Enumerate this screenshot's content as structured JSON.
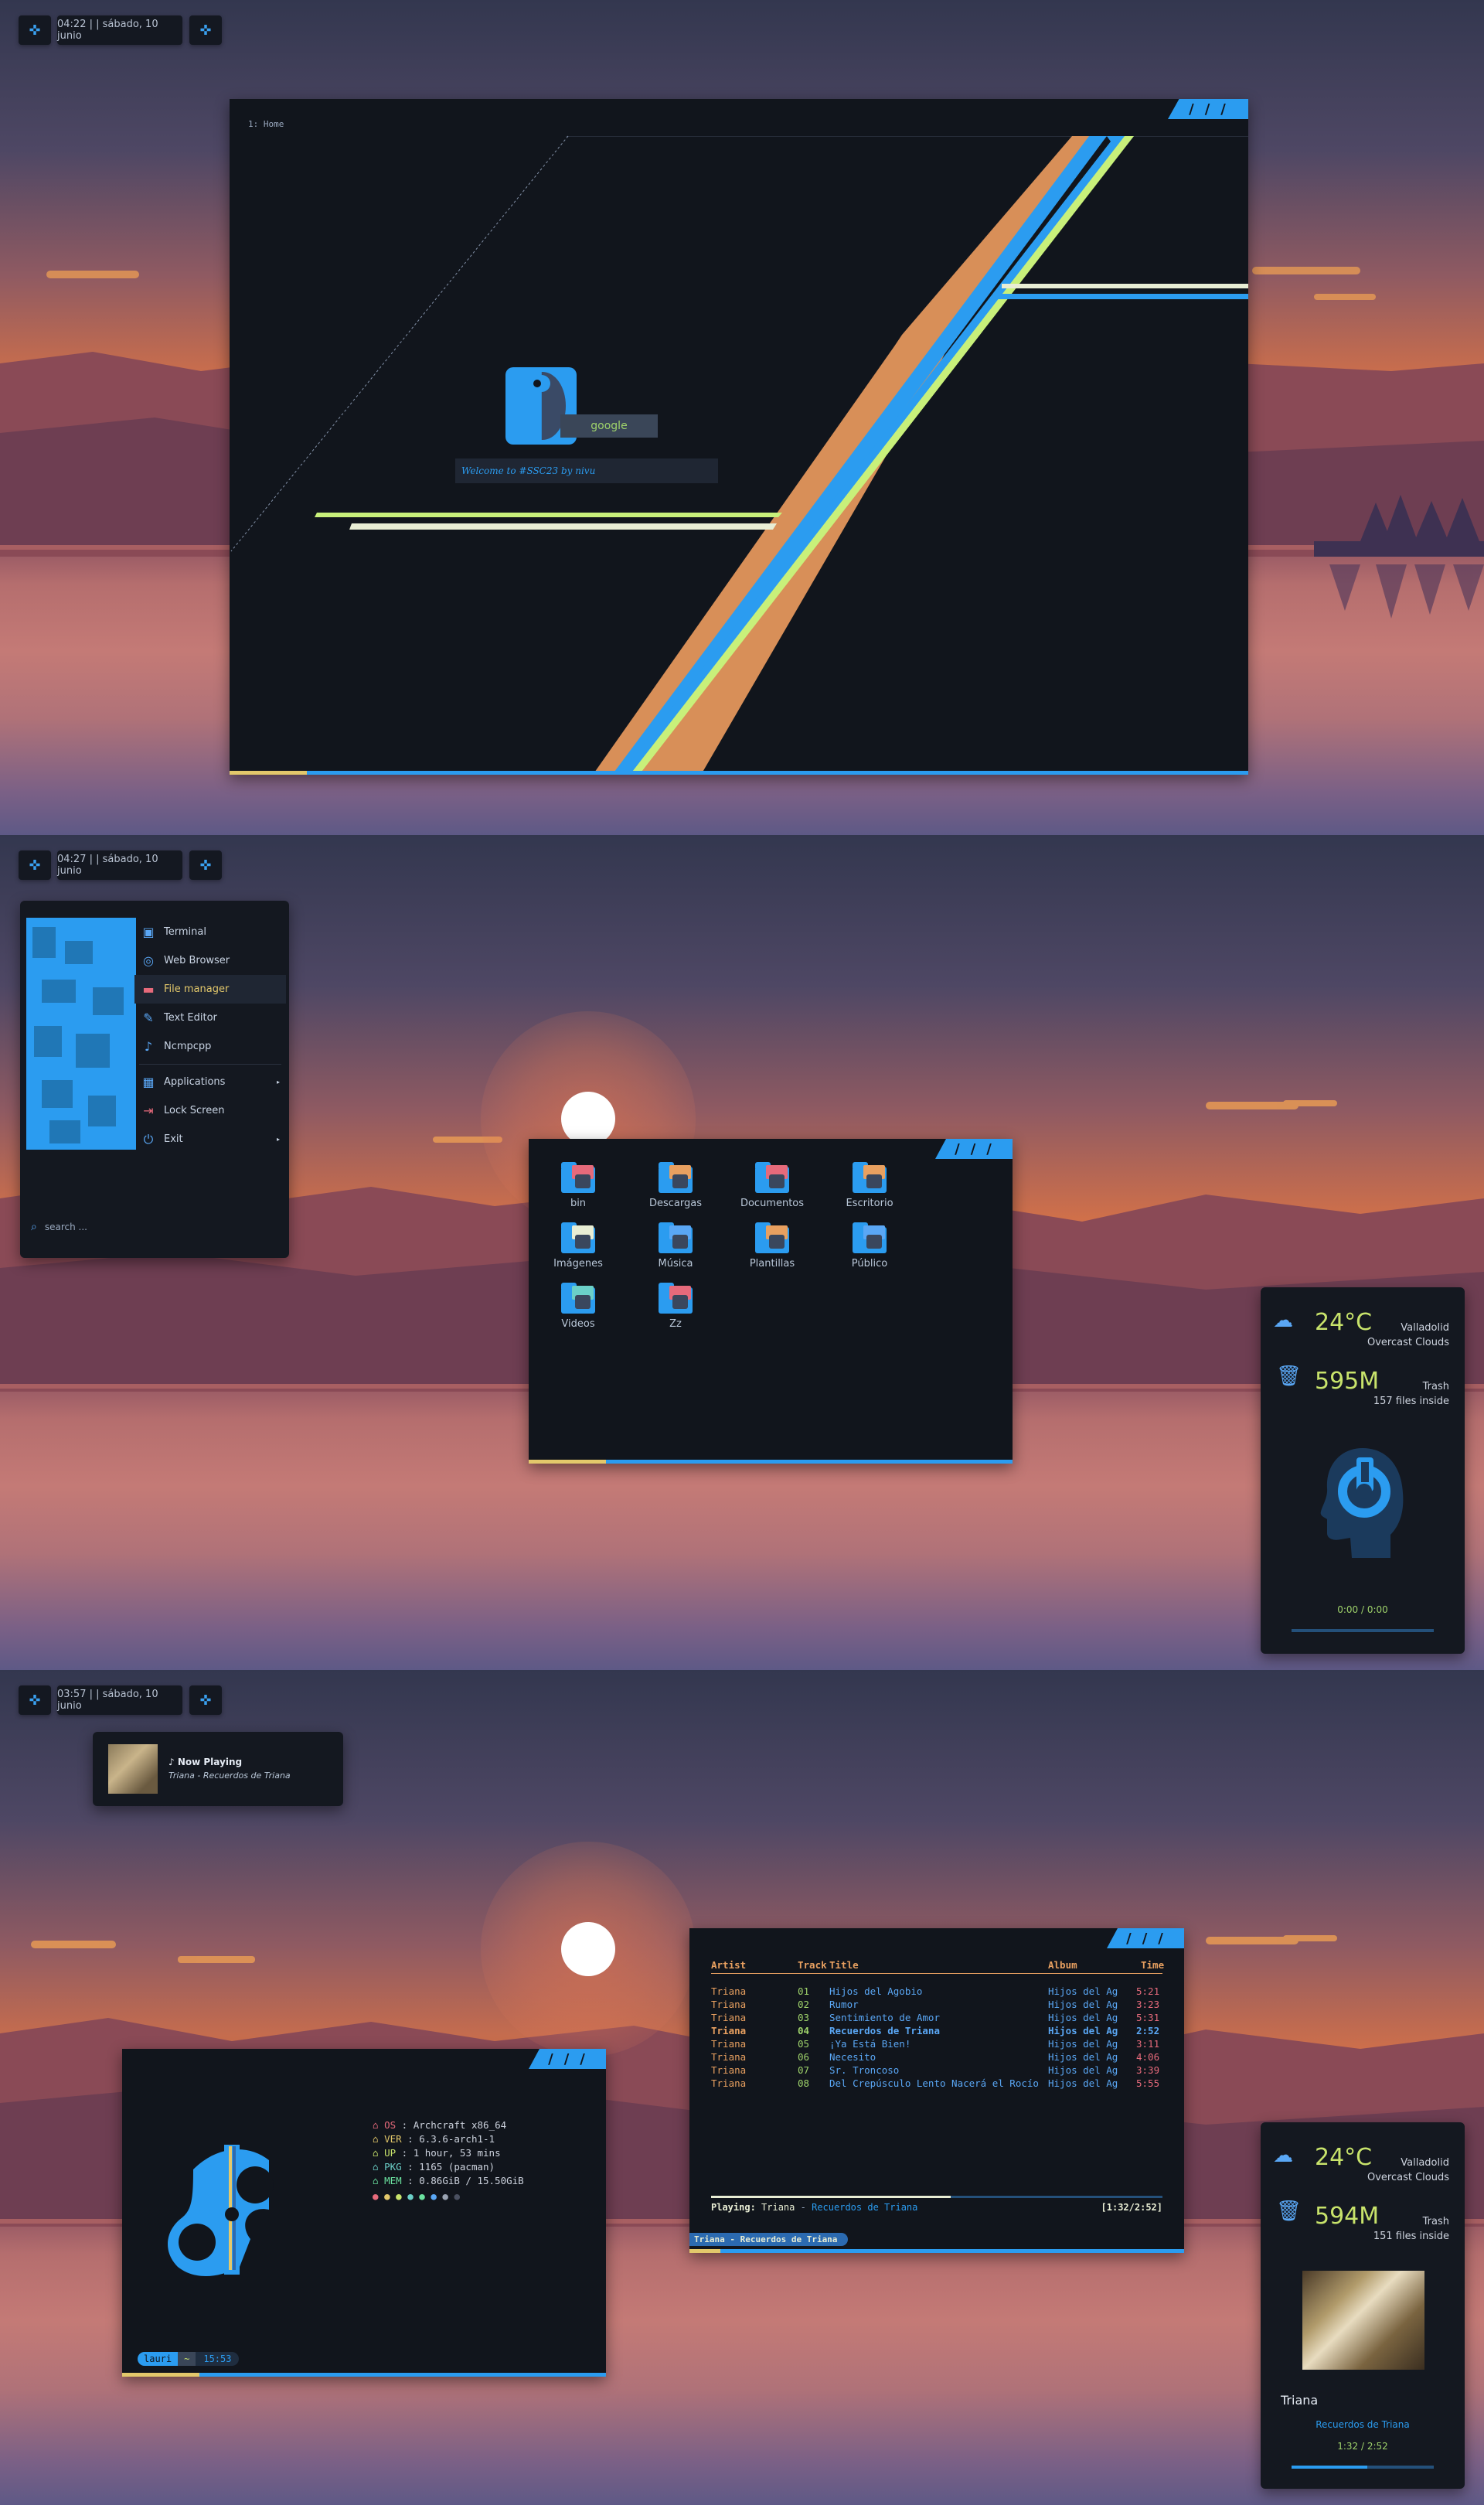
{
  "panels": [
    {
      "bar": {
        "time_date": "04:22 | | sábado, 10 junio"
      },
      "home_window": {
        "workspace": "1: Home",
        "google_label": "google",
        "welcome": "Welcome to #SSC23 by nivu"
      }
    },
    {
      "bar": {
        "time_date": "04:27 | | sábado, 10 junio"
      },
      "launcher": {
        "items": [
          {
            "label": "Terminal",
            "icon": "terminal-icon"
          },
          {
            "label": "Web Browser",
            "icon": "globe-icon"
          },
          {
            "label": "File manager",
            "icon": "folder-icon"
          },
          {
            "label": "Text Editor",
            "icon": "edit-icon"
          },
          {
            "label": "Ncmpcpp",
            "icon": "music-note-icon"
          }
        ],
        "items2": [
          {
            "label": "Applications",
            "icon": "grid-icon"
          },
          {
            "label": "Lock Screen",
            "icon": "lock-icon"
          },
          {
            "label": "Exit",
            "icon": "power-icon"
          }
        ],
        "search_placeholder": "search ..."
      },
      "files": [
        "bin",
        "Descargas",
        "Documentos",
        "Escritorio",
        "Imágenes",
        "Música",
        "Plantillas",
        "Público",
        "Videos",
        "Zz"
      ],
      "sidebar": {
        "temp": "24°C",
        "city": "Valladolid",
        "weather": "Overcast Clouds",
        "trash_size": "595M",
        "trash_label": "Trash",
        "trash_files": "157 files inside",
        "time": "0:00 / 0:00",
        "progress": 0
      }
    },
    {
      "bar": {
        "time_date": "03:57 | | sábado, 10 junio"
      },
      "now_playing": {
        "title": "♪ Now Playing",
        "track": "Triana - Recuerdos de Triana"
      },
      "fetch": {
        "lines": [
          {
            "key": "OS",
            "value": ": Archcraft x86_64",
            "color": "#e66a7b"
          },
          {
            "key": "VER",
            "value": ": 6.3.6-arch1-1",
            "color": "#e3c86b"
          },
          {
            "key": "UP",
            "value": ": 1 hour, 53 mins",
            "color": "#c8e36b"
          },
          {
            "key": "PKG",
            "value": ": 1165 (pacman)",
            "color": "#6bd0c8"
          },
          {
            "key": "MEM",
            "value": ": 0.86GiB / 15.50GiB",
            "color": "#6be3a0"
          }
        ],
        "dots": [
          "#e66a7b",
          "#e3c86b",
          "#c8e36b",
          "#6bd0c8",
          "#6be3a0",
          "#5aa7f5",
          "#9aa3b2",
          "#4a5060"
        ],
        "prompt_user": "lauri",
        "prompt_sep": "~",
        "prompt_time": "15:53"
      },
      "player": {
        "headers": [
          "Artist",
          "Track",
          "Title",
          "Album",
          "Time"
        ],
        "rows": [
          {
            "artist": "Triana",
            "track": "01",
            "title": "Hijos del Agobio",
            "album": "Hijos del Ag",
            "time": "5:21"
          },
          {
            "artist": "Triana",
            "track": "02",
            "title": "Rumor",
            "album": "Hijos del Ag",
            "time": "3:23"
          },
          {
            "artist": "Triana",
            "track": "03",
            "title": "Sentimiento de Amor",
            "album": "Hijos del Ag",
            "time": "5:31"
          },
          {
            "artist": "Triana",
            "track": "04",
            "title": "Recuerdos de Triana",
            "album": "Hijos del Ag",
            "time": "2:52"
          },
          {
            "artist": "Triana",
            "track": "05",
            "title": "¡Ya Está Bien!",
            "album": "Hijos del Ag",
            "time": "3:11"
          },
          {
            "artist": "Triana",
            "track": "06",
            "title": "Necesito",
            "album": "Hijos del Ag",
            "time": "4:06"
          },
          {
            "artist": "Triana",
            "track": "07",
            "title": "Sr. Troncoso",
            "album": "Hijos del Ag",
            "time": "3:39"
          },
          {
            "artist": "Triana",
            "track": "08",
            "title": "Del Crepúsculo Lento Nacerá el Rocío",
            "album": "Hijos del Ag",
            "time": "5:55"
          }
        ],
        "playing_label": "Playing:",
        "playing_artist": "Triana",
        "playing_sep": "-",
        "playing_title": "Recuerdos de Triana",
        "elapsed": "[1:32/2:52]",
        "status_track": "Triana - Recuerdos de Triana",
        "progress": 0.53
      },
      "sidebar": {
        "temp": "24°C",
        "city": "Valladolid",
        "weather": "Overcast Clouds",
        "trash_size": "594M",
        "trash_label": "Trash",
        "trash_files": "151 files inside",
        "artist": "Triana",
        "track": "Recuerdos de Triana",
        "time": "1:32 / 2:52",
        "progress": 0.53
      }
    }
  ]
}
